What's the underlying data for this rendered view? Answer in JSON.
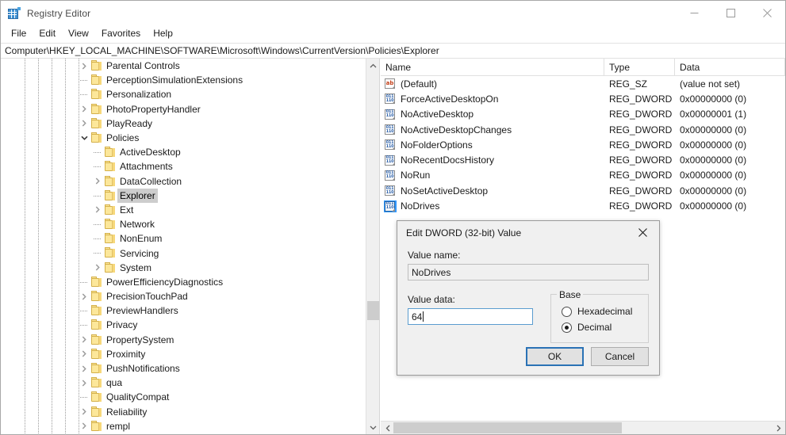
{
  "window": {
    "title": "Registry Editor",
    "icon": "registry-icon",
    "controls": {
      "minimize": "minimize-icon",
      "maximize": "maximize-icon",
      "close": "close-icon"
    }
  },
  "menu": {
    "items": [
      "File",
      "Edit",
      "View",
      "Favorites",
      "Help"
    ]
  },
  "address": {
    "path": "Computer\\HKEY_LOCAL_MACHINE\\SOFTWARE\\Microsoft\\Windows\\CurrentVersion\\Policies\\Explorer"
  },
  "tree": {
    "nodes": [
      {
        "label": "Parental Controls",
        "indent": 5,
        "state": "collapsed",
        "selected": false
      },
      {
        "label": "PerceptionSimulationExtensions",
        "indent": 5,
        "state": "leaf",
        "selected": false
      },
      {
        "label": "Personalization",
        "indent": 5,
        "state": "leaf",
        "selected": false
      },
      {
        "label": "PhotoPropertyHandler",
        "indent": 5,
        "state": "collapsed",
        "selected": false
      },
      {
        "label": "PlayReady",
        "indent": 5,
        "state": "collapsed",
        "selected": false
      },
      {
        "label": "Policies",
        "indent": 5,
        "state": "expanded",
        "selected": false
      },
      {
        "label": "ActiveDesktop",
        "indent": 6,
        "state": "leaf",
        "selected": false
      },
      {
        "label": "Attachments",
        "indent": 6,
        "state": "leaf",
        "selected": false
      },
      {
        "label": "DataCollection",
        "indent": 6,
        "state": "collapsed",
        "selected": false
      },
      {
        "label": "Explorer",
        "indent": 6,
        "state": "leaf",
        "selected": true
      },
      {
        "label": "Ext",
        "indent": 6,
        "state": "collapsed",
        "selected": false
      },
      {
        "label": "Network",
        "indent": 6,
        "state": "leaf",
        "selected": false
      },
      {
        "label": "NonEnum",
        "indent": 6,
        "state": "leaf",
        "selected": false
      },
      {
        "label": "Servicing",
        "indent": 6,
        "state": "leaf",
        "selected": false
      },
      {
        "label": "System",
        "indent": 6,
        "state": "collapsed",
        "selected": false
      },
      {
        "label": "PowerEfficiencyDiagnostics",
        "indent": 5,
        "state": "leaf",
        "selected": false
      },
      {
        "label": "PrecisionTouchPad",
        "indent": 5,
        "state": "collapsed",
        "selected": false
      },
      {
        "label": "PreviewHandlers",
        "indent": 5,
        "state": "leaf",
        "selected": false
      },
      {
        "label": "Privacy",
        "indent": 5,
        "state": "leaf",
        "selected": false
      },
      {
        "label": "PropertySystem",
        "indent": 5,
        "state": "collapsed",
        "selected": false
      },
      {
        "label": "Proximity",
        "indent": 5,
        "state": "collapsed",
        "selected": false
      },
      {
        "label": "PushNotifications",
        "indent": 5,
        "state": "collapsed",
        "selected": false
      },
      {
        "label": "qua",
        "indent": 5,
        "state": "collapsed",
        "selected": false
      },
      {
        "label": "QualityCompat",
        "indent": 5,
        "state": "leaf",
        "selected": false
      },
      {
        "label": "Reliability",
        "indent": 5,
        "state": "collapsed",
        "selected": false
      },
      {
        "label": "rempl",
        "indent": 5,
        "state": "collapsed",
        "selected": false
      }
    ],
    "scrollbar": {
      "up": "scroll-up-icon",
      "down": "scroll-down-icon"
    }
  },
  "values": {
    "columns": [
      "Name",
      "Type",
      "Data"
    ],
    "rows": [
      {
        "name": "(Default)",
        "type": "REG_SZ",
        "data": "(value not set)",
        "icon": "string-value-icon",
        "selected": false
      },
      {
        "name": "ForceActiveDesktopOn",
        "type": "REG_DWORD",
        "data": "0x00000000 (0)",
        "icon": "dword-value-icon",
        "selected": false
      },
      {
        "name": "NoActiveDesktop",
        "type": "REG_DWORD",
        "data": "0x00000001 (1)",
        "icon": "dword-value-icon",
        "selected": false
      },
      {
        "name": "NoActiveDesktopChanges",
        "type": "REG_DWORD",
        "data": "0x00000000 (0)",
        "icon": "dword-value-icon",
        "selected": false
      },
      {
        "name": "NoFolderOptions",
        "type": "REG_DWORD",
        "data": "0x00000000 (0)",
        "icon": "dword-value-icon",
        "selected": false
      },
      {
        "name": "NoRecentDocsHistory",
        "type": "REG_DWORD",
        "data": "0x00000000 (0)",
        "icon": "dword-value-icon",
        "selected": false
      },
      {
        "name": "NoRun",
        "type": "REG_DWORD",
        "data": "0x00000000 (0)",
        "icon": "dword-value-icon",
        "selected": false
      },
      {
        "name": "NoSetActiveDesktop",
        "type": "REG_DWORD",
        "data": "0x00000000 (0)",
        "icon": "dword-value-icon",
        "selected": false
      },
      {
        "name": "NoDrives",
        "type": "REG_DWORD",
        "data": "0x00000000 (0)",
        "icon": "dword-value-icon",
        "selected": true
      }
    ],
    "scrollbar": {
      "left": "scroll-left-icon",
      "right": "scroll-right-icon"
    }
  },
  "dialog": {
    "title": "Edit DWORD (32-bit) Value",
    "close": "close-icon",
    "value_name_label": "Value name:",
    "value_name": "NoDrives",
    "value_data_label": "Value data:",
    "value_data": "64",
    "base_legend": "Base",
    "base_options": [
      "Hexadecimal",
      "Decimal"
    ],
    "base_selected": "Decimal",
    "ok_label": "OK",
    "cancel_label": "Cancel"
  },
  "colors": {
    "accent": "#2a72b5",
    "selection": "#3399ff",
    "folder": "#fce79a",
    "tree_selected": "#cdcdcd"
  }
}
